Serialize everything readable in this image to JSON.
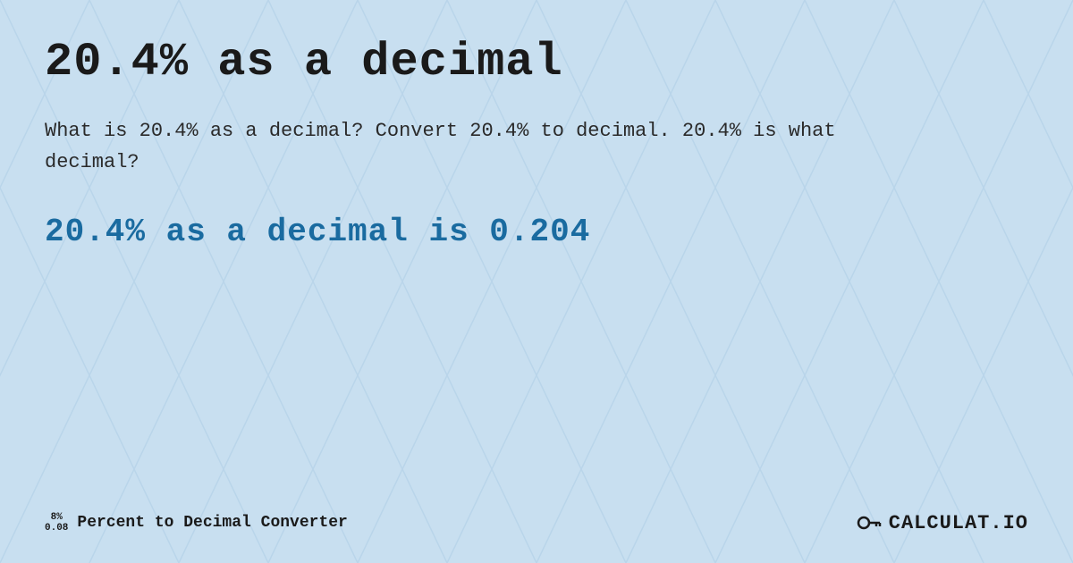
{
  "page": {
    "title": "20.4% as a decimal",
    "background_color": "#c8dff0",
    "description": "What is 20.4% as a decimal? Convert 20.4% to decimal. 20.4% is what decimal?",
    "result": "20.4% as a decimal is 0.204",
    "footer": {
      "icon_top": "8%",
      "icon_bottom": "0.08",
      "label": "Percent to Decimal Converter",
      "logo_text": "CALCULAT.IO"
    }
  }
}
